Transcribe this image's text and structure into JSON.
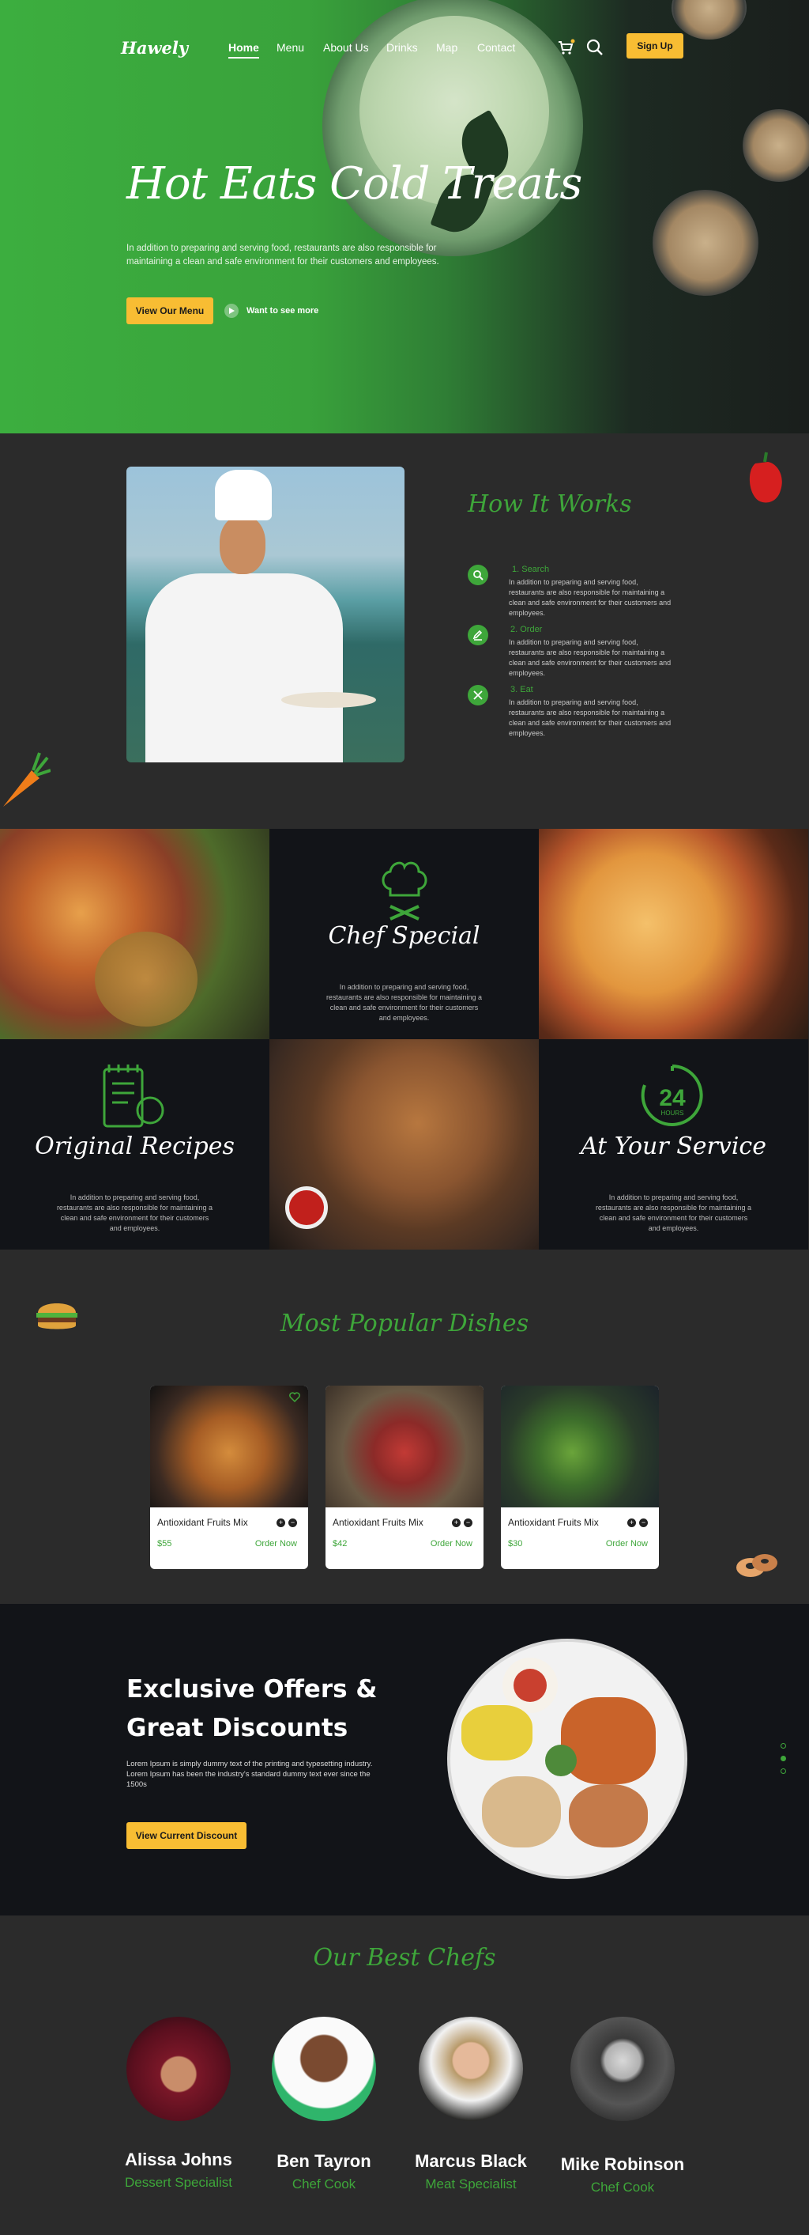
{
  "nav": {
    "logo": "Hawely",
    "links": [
      "Home",
      "Menu",
      "About Us",
      "Drinks",
      "Map",
      "Contact"
    ],
    "signup": "Sign Up"
  },
  "hero": {
    "title": "Hot Eats Cold Treats",
    "text": "In addition to preparing and serving food, restaurants are also responsible for maintaining a clean and safe environment for their customers and employees.",
    "menu_button": "View Our Menu",
    "see_more": "Want to see more"
  },
  "how": {
    "title": "How It Works",
    "steps": [
      {
        "title": "1. Search",
        "text": "In addition to preparing and serving food, restaurants are also responsible for maintaining a clean and safe environment for their customers and employees."
      },
      {
        "title": "2. Order",
        "text": "In addition to preparing and serving food, restaurants are also responsible for maintaining a clean and safe environment for their customers and employees."
      },
      {
        "title": "3. Eat",
        "text": "In addition to preparing and serving food, restaurants are also responsible for maintaining a clean and safe environment for their customers and employees."
      }
    ]
  },
  "features": {
    "chef_special": {
      "title": "Chef Special",
      "text": "In addition to preparing and serving food, restaurants are also responsible for maintaining a clean and safe environment for their customers and employees."
    },
    "original_recipes": {
      "title": "Original Recipes",
      "text": "In addition to preparing and serving food, restaurants are also responsible for maintaining a clean and safe environment for their customers and employees."
    },
    "at_your_service": {
      "title": "At Your Service",
      "text": "In addition to preparing and serving food, restaurants are also responsible for maintaining a clean and safe environment for their customers and employees.",
      "badge_number": "24",
      "badge_label": "HOURS"
    }
  },
  "popular": {
    "title": "Most Popular Dishes",
    "dishes": [
      {
        "name": "Antioxidant Fruits Mix",
        "price": "$55",
        "order": "Order Now"
      },
      {
        "name": "Antioxidant Fruits Mix",
        "price": "$42",
        "order": "Order Now"
      },
      {
        "name": "Antioxidant Fruits Mix",
        "price": "$30",
        "order": "Order Now"
      }
    ]
  },
  "offers": {
    "title": "Exclusive Offers & Great Discounts",
    "text": "Lorem Ipsum is simply dummy text of the printing and typesetting industry. Lorem Ipsum has been the industry's standard dummy text ever since the 1500s",
    "button": "View Current Discount"
  },
  "chefs": {
    "title": "Our Best Chefs",
    "list": [
      {
        "name": "Alissa Johns",
        "role": "Dessert Specialist"
      },
      {
        "name": "Ben Tayron",
        "role": "Chef Cook"
      },
      {
        "name": "Marcus Black",
        "role": "Meat Specialist"
      },
      {
        "name": "Mike Robinson",
        "role": "Chef Cook"
      }
    ]
  },
  "colors": {
    "accent": "#3ea63a",
    "button": "#f8bd33",
    "dark": "#121418",
    "panel": "#2b2b2b"
  }
}
